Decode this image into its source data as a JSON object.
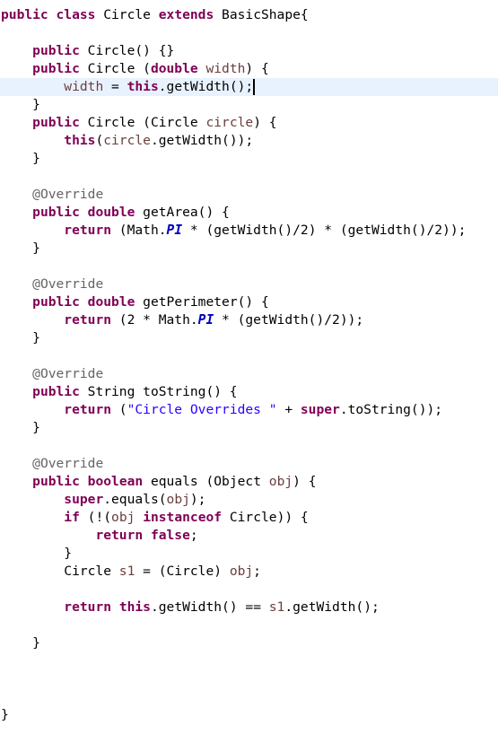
{
  "editor": {
    "language": "java",
    "current_line_index": 4,
    "colors": {
      "keyword": "#7f0055",
      "variable": "#6a3e3e",
      "annotation": "#646464",
      "string": "#2a00ff",
      "constant": "#0000c0",
      "current_line_bg": "#e8f2fe"
    },
    "lines": [
      [
        [
          "kw",
          "public"
        ],
        [
          "t",
          " "
        ],
        [
          "kw",
          "class"
        ],
        [
          "t",
          " Circle "
        ],
        [
          "kw",
          "extends"
        ],
        [
          "t",
          " BasicShape{"
        ]
      ],
      [],
      [
        [
          "t",
          "    "
        ],
        [
          "kw",
          "public"
        ],
        [
          "t",
          " Circle() {}"
        ]
      ],
      [
        [
          "t",
          "    "
        ],
        [
          "kw",
          "public"
        ],
        [
          "t",
          " Circle ("
        ],
        [
          "kw",
          "double"
        ],
        [
          "t",
          " "
        ],
        [
          "var",
          "width"
        ],
        [
          "t",
          ") {"
        ]
      ],
      [
        [
          "t",
          "        "
        ],
        [
          "var",
          "width"
        ],
        [
          "t",
          " = "
        ],
        [
          "kw",
          "this"
        ],
        [
          "t",
          ".getWidth();"
        ],
        [
          "caret",
          ""
        ]
      ],
      [
        [
          "t",
          "    }"
        ]
      ],
      [
        [
          "t",
          "    "
        ],
        [
          "kw",
          "public"
        ],
        [
          "t",
          " Circle (Circle "
        ],
        [
          "var",
          "circle"
        ],
        [
          "t",
          ") {"
        ]
      ],
      [
        [
          "t",
          "        "
        ],
        [
          "kw",
          "this"
        ],
        [
          "t",
          "("
        ],
        [
          "var",
          "circle"
        ],
        [
          "t",
          ".getWidth());"
        ]
      ],
      [
        [
          "t",
          "    }"
        ]
      ],
      [],
      [
        [
          "t",
          "    "
        ],
        [
          "ann",
          "@Override"
        ]
      ],
      [
        [
          "t",
          "    "
        ],
        [
          "kw",
          "public"
        ],
        [
          "t",
          " "
        ],
        [
          "kw",
          "double"
        ],
        [
          "t",
          " getArea() {"
        ]
      ],
      [
        [
          "t",
          "        "
        ],
        [
          "kw",
          "return"
        ],
        [
          "t",
          " (Math."
        ],
        [
          "const",
          "PI"
        ],
        [
          "t",
          " * (getWidth()/2) * (getWidth()/2));"
        ]
      ],
      [
        [
          "t",
          "    }"
        ]
      ],
      [],
      [
        [
          "t",
          "    "
        ],
        [
          "ann",
          "@Override"
        ]
      ],
      [
        [
          "t",
          "    "
        ],
        [
          "kw",
          "public"
        ],
        [
          "t",
          " "
        ],
        [
          "kw",
          "double"
        ],
        [
          "t",
          " getPerimeter() {"
        ]
      ],
      [
        [
          "t",
          "        "
        ],
        [
          "kw",
          "return"
        ],
        [
          "t",
          " (2 * Math."
        ],
        [
          "const",
          "PI"
        ],
        [
          "t",
          " * (getWidth()/2));"
        ]
      ],
      [
        [
          "t",
          "    }"
        ]
      ],
      [],
      [
        [
          "t",
          "    "
        ],
        [
          "ann",
          "@Override"
        ]
      ],
      [
        [
          "t",
          "    "
        ],
        [
          "kw",
          "public"
        ],
        [
          "t",
          " String toString() {"
        ]
      ],
      [
        [
          "t",
          "        "
        ],
        [
          "kw",
          "return"
        ],
        [
          "t",
          " ("
        ],
        [
          "str",
          "\"Circle Overrides \""
        ],
        [
          "t",
          " + "
        ],
        [
          "kw",
          "super"
        ],
        [
          "t",
          ".toString());"
        ]
      ],
      [
        [
          "t",
          "    }"
        ]
      ],
      [],
      [
        [
          "t",
          "    "
        ],
        [
          "ann",
          "@Override"
        ]
      ],
      [
        [
          "t",
          "    "
        ],
        [
          "kw",
          "public"
        ],
        [
          "t",
          " "
        ],
        [
          "kw",
          "boolean"
        ],
        [
          "t",
          " equals (Object "
        ],
        [
          "var",
          "obj"
        ],
        [
          "t",
          ") {"
        ]
      ],
      [
        [
          "t",
          "        "
        ],
        [
          "kw",
          "super"
        ],
        [
          "t",
          ".equals("
        ],
        [
          "var",
          "obj"
        ],
        [
          "t",
          ");"
        ]
      ],
      [
        [
          "t",
          "        "
        ],
        [
          "kw",
          "if"
        ],
        [
          "t",
          " (!("
        ],
        [
          "var",
          "obj"
        ],
        [
          "t",
          " "
        ],
        [
          "kw",
          "instanceof"
        ],
        [
          "t",
          " Circle)) {"
        ]
      ],
      [
        [
          "t",
          "            "
        ],
        [
          "kw",
          "return"
        ],
        [
          "t",
          " "
        ],
        [
          "kw",
          "false"
        ],
        [
          "t",
          ";"
        ]
      ],
      [
        [
          "t",
          "        }"
        ]
      ],
      [
        [
          "t",
          "        Circle "
        ],
        [
          "var",
          "s1"
        ],
        [
          "t",
          " = (Circle) "
        ],
        [
          "var",
          "obj"
        ],
        [
          "t",
          ";"
        ]
      ],
      [],
      [
        [
          "t",
          "        "
        ],
        [
          "kw",
          "return"
        ],
        [
          "t",
          " "
        ],
        [
          "kw",
          "this"
        ],
        [
          "t",
          ".getWidth() == "
        ],
        [
          "var",
          "s1"
        ],
        [
          "t",
          ".getWidth();"
        ]
      ],
      [],
      [
        [
          "t",
          "    }"
        ]
      ],
      [],
      [],
      [],
      [
        [
          "t",
          "}"
        ]
      ]
    ]
  }
}
